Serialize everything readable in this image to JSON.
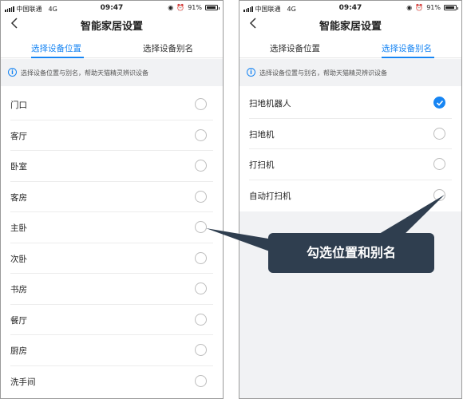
{
  "statusbar": {
    "carrier": "中国联通",
    "network": "4G",
    "time": "09:47",
    "battery": "91%",
    "battery_level": 0.91
  },
  "nav": {
    "back_label": "<",
    "title": "智能家居设置"
  },
  "tabs": {
    "location": "选择设备位置",
    "alias": "选择设备别名"
  },
  "notice": "选择设备位置与别名，帮助天猫精灵辨识设备",
  "left_screen": {
    "active_tab": "location",
    "items": [
      {
        "label": "门口",
        "checked": false
      },
      {
        "label": "客厅",
        "checked": false
      },
      {
        "label": "卧室",
        "checked": false
      },
      {
        "label": "客房",
        "checked": false
      },
      {
        "label": "主卧",
        "checked": false
      },
      {
        "label": "次卧",
        "checked": false
      },
      {
        "label": "书房",
        "checked": false
      },
      {
        "label": "餐厅",
        "checked": false
      },
      {
        "label": "厨房",
        "checked": false
      },
      {
        "label": "洗手间",
        "checked": false
      }
    ]
  },
  "right_screen": {
    "active_tab": "alias",
    "items": [
      {
        "label": "扫地机器人",
        "checked": true
      },
      {
        "label": "扫地机",
        "checked": false
      },
      {
        "label": "打扫机",
        "checked": false
      },
      {
        "label": "自动打扫机",
        "checked": false
      }
    ]
  },
  "callout": {
    "text": "勾选位置和别名",
    "bg": "#2f3e4f"
  },
  "colors": {
    "accent": "#1785f3",
    "notice_bg": "#f1f2f4"
  }
}
